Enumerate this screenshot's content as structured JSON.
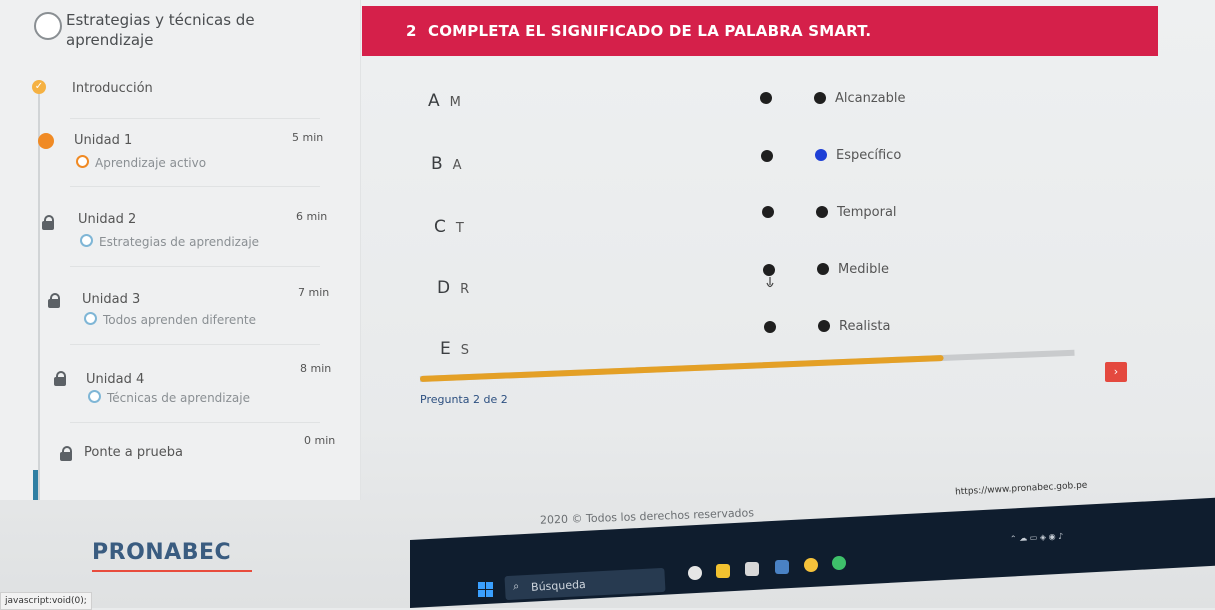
{
  "sidebar": {
    "course_title": "Estrategias y técnicas de aprendizaje",
    "intro": {
      "title": "Introducción"
    },
    "units": [
      {
        "title": "Unidad 1",
        "duration": "5 min",
        "subtitle": "Aprendizaje activo"
      },
      {
        "title": "Unidad 2",
        "duration": "6 min",
        "subtitle": "Estrategias de aprendizaje"
      },
      {
        "title": "Unidad 3",
        "duration": "7 min",
        "subtitle": "Todos aprenden diferente"
      },
      {
        "title": "Unidad 4",
        "duration": "8 min",
        "subtitle": "Técnicas de aprendizaje"
      }
    ],
    "final": {
      "title": "Ponte a prueba",
      "duration": "0 min"
    }
  },
  "question": {
    "number": "2",
    "text": "COMPLETA EL SIGNIFICADO DE LA PALABRA SMART.",
    "left_items": [
      {
        "letter": "A",
        "hint": "M"
      },
      {
        "letter": "B",
        "hint": "A"
      },
      {
        "letter": "C",
        "hint": "T"
      },
      {
        "letter": "D",
        "hint": "R"
      },
      {
        "letter": "E",
        "hint": "S"
      }
    ],
    "right_options": [
      "Alcanzable",
      "Específico",
      "Temporal",
      "Medible",
      "Realista"
    ],
    "selected_option": "Específico",
    "progress_label": "Pregunta 2 de 2",
    "progress": 0.8,
    "next_label": "›"
  },
  "footer": {
    "url": "https://www.pronabec.gob.pe",
    "copyright": "2020 © Todos los derechos reservados",
    "logo": "PRONABEC",
    "status_bar": "javascript:void(0);"
  },
  "taskbar": {
    "search_label": "Búsqueda"
  },
  "colors": {
    "banner": "#d5204a",
    "progress": "#e4a026",
    "selected_dot": "#1e3fd6"
  }
}
